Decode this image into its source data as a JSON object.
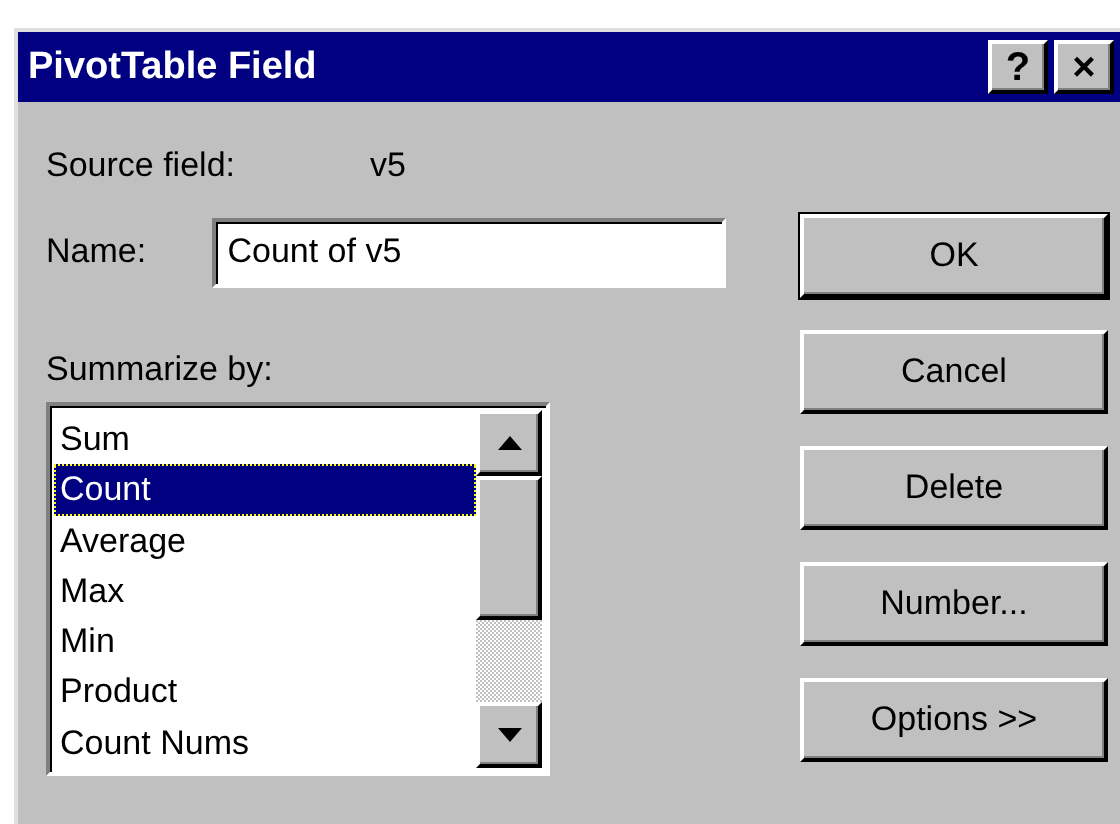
{
  "window": {
    "title": "PivotTable Field",
    "help_button": "?",
    "close_button": "×"
  },
  "source_field": {
    "label": "Source field:",
    "value": "v5"
  },
  "name": {
    "label": "Name:",
    "value": "Count of v5"
  },
  "summarize": {
    "label": "Summarize by:",
    "items": [
      {
        "label": "Sum",
        "selected": false
      },
      {
        "label": "Count",
        "selected": true
      },
      {
        "label": "Average",
        "selected": false
      },
      {
        "label": "Max",
        "selected": false
      },
      {
        "label": "Min",
        "selected": false
      },
      {
        "label": "Product",
        "selected": false
      },
      {
        "label": "Count Nums",
        "selected": false
      }
    ]
  },
  "buttons": [
    {
      "label": "OK",
      "default": true
    },
    {
      "label": "Cancel",
      "default": false
    },
    {
      "label": "Delete",
      "default": false
    },
    {
      "label": "Number...",
      "default": false
    },
    {
      "label": "Options >>",
      "default": false
    }
  ]
}
